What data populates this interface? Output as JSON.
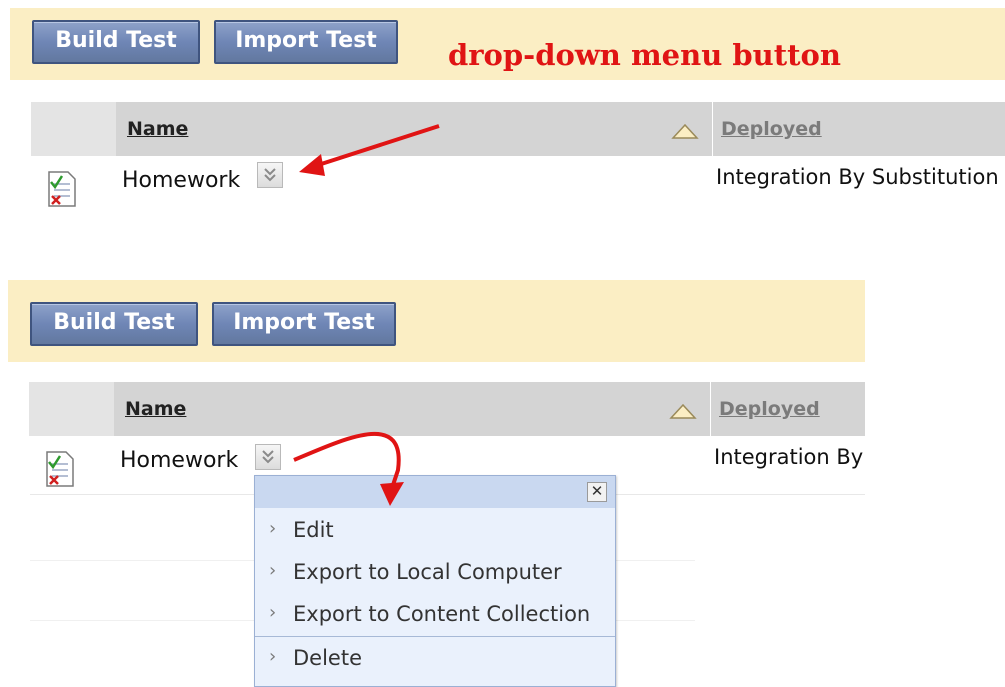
{
  "annotation": {
    "text": "drop-down menu button"
  },
  "toolbar": {
    "build_test_label": "Build Test",
    "import_test_label": "Import Test"
  },
  "table": {
    "columns": {
      "name": "Name",
      "deployed": "Deployed"
    },
    "rows": [
      {
        "name": "Homework",
        "deployed_full": "Integration By Substitution",
        "deployed_truncated": "Integration By"
      }
    ]
  },
  "dropdown_menu": {
    "items": [
      "Edit",
      "Export to Local Computer",
      "Export to Content Collection",
      "Delete"
    ]
  },
  "colors": {
    "annotation_red": "#e01414",
    "toolbar_bg": "#fbeec4",
    "button_blue": "#6f86b6",
    "menu_bg": "#eaf1fc",
    "menu_header": "#c9d8f0"
  },
  "icons": [
    "test-file-icon",
    "chevron-down-icon",
    "sort-ascending-icon",
    "close-icon",
    "chevron-right-icon",
    "red-arrow"
  ]
}
